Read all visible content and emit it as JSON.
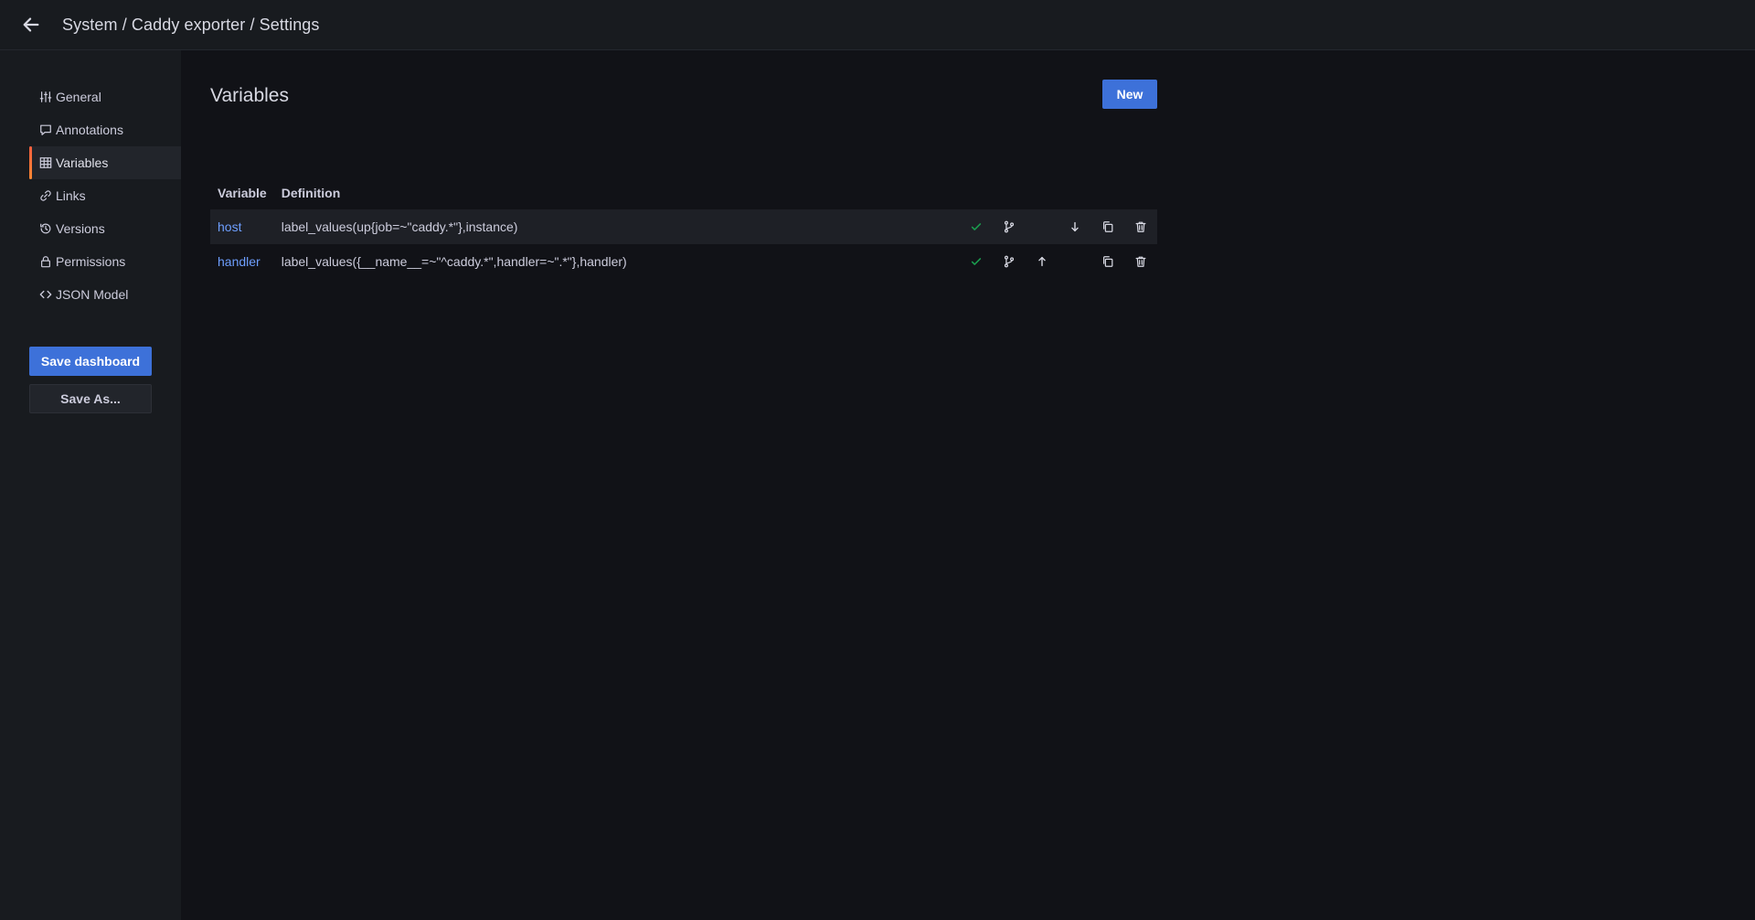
{
  "breadcrumb": "System / Caddy exporter / Settings",
  "sidebar": {
    "items": [
      {
        "label": "General",
        "icon": "sliders-icon"
      },
      {
        "label": "Annotations",
        "icon": "comment-icon"
      },
      {
        "label": "Variables",
        "icon": "table-icon",
        "active": true
      },
      {
        "label": "Links",
        "icon": "link-icon"
      },
      {
        "label": "Versions",
        "icon": "history-icon"
      },
      {
        "label": "Permissions",
        "icon": "lock-icon"
      },
      {
        "label": "JSON Model",
        "icon": "code-icon"
      }
    ],
    "save_label": "Save dashboard",
    "save_as_label": "Save As..."
  },
  "main": {
    "title": "Variables",
    "new_label": "New",
    "table": {
      "columns": [
        "Variable",
        "Definition"
      ],
      "rows": [
        {
          "name": "host",
          "definition": "label_values(up{job=~\"caddy.*\"},instance)"
        },
        {
          "name": "handler",
          "definition": "label_values({__name__=~\"^caddy.*\",handler=~\".*\"},handler)"
        }
      ]
    }
  },
  "colors": {
    "accent": "#3d71d9",
    "link": "#6e9fff",
    "success": "#1a9c4e",
    "active_bar": "#f55f3e"
  }
}
